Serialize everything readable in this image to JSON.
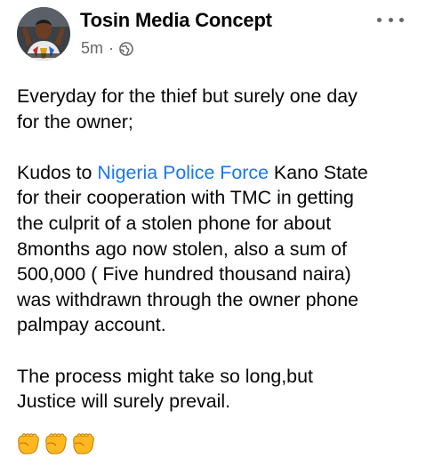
{
  "post": {
    "author": "Tosin Media Concept",
    "time": "5m",
    "separator": "·",
    "privacy_icon": "globe-icon",
    "menu_icon": "more-horizontal-icon",
    "paragraphs": [
      {
        "lines": [
          {
            "text": "Everyday for the thief but surely one day"
          },
          {
            "text": "for the owner;"
          }
        ]
      },
      {
        "lines": [
          {
            "pre": "Kudos to ",
            "link": "Nigeria Police Force",
            "post": " Kano State"
          },
          {
            "text": "for their cooperation with TMC in getting"
          },
          {
            "text": "the culprit of a stolen phone for about"
          },
          {
            "text": "8months ago now stolen, also a sum of"
          },
          {
            "text": "500,000 ( Five hundred thousand naira)"
          },
          {
            "text": "was withdrawn through the owner phone"
          },
          {
            "text": "palmpay account."
          }
        ]
      },
      {
        "lines": [
          {
            "text": "The process might take so long,but"
          },
          {
            "text": "Justice will surely prevail."
          }
        ]
      }
    ],
    "emoji": [
      "raised-fist-icon",
      "raised-fist-icon",
      "raised-fist-icon"
    ],
    "colors": {
      "link": "#1877f2",
      "meta": "#65676b",
      "text": "#050505",
      "emoji": "#ffb81f"
    }
  }
}
